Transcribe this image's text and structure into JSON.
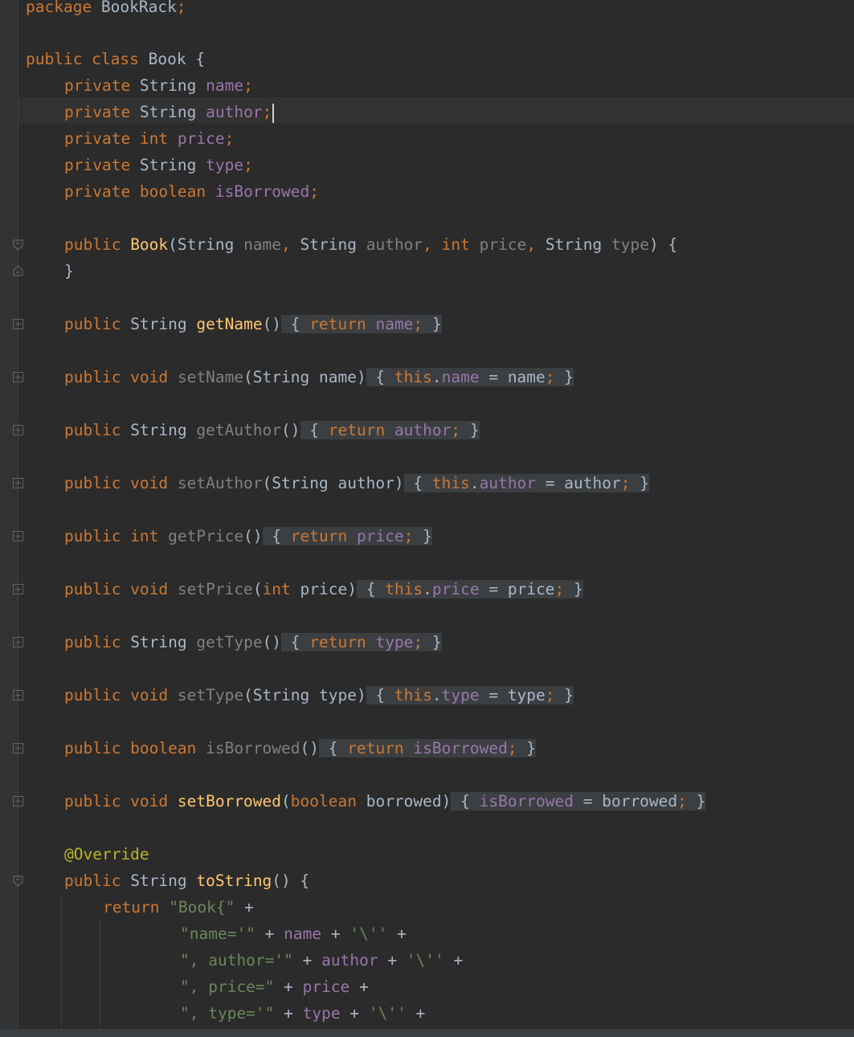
{
  "editor": {
    "language": "java",
    "colors": {
      "background": "#2b2b2b",
      "keyword": "#cc7832",
      "field": "#9876aa",
      "parameter": "#808080",
      "string": "#6a8759",
      "method": "#ffc66d",
      "annotation": "#bbb529",
      "text": "#a9b7c6"
    },
    "code": {
      "l1_kw": "package",
      "l1_name": " BookRack",
      "l1_end": ";",
      "l3_kw": "public class",
      "l3_rest": " Book {",
      "l4_kw": "private",
      "l4_type": " String ",
      "l4_field": "name",
      "l4_end": ";",
      "l5_kw": "private",
      "l5_type": " String ",
      "l5_field": "author",
      "l5_end": ";",
      "l6_kw": "private int",
      "l6_field": " price",
      "l6_end": ";",
      "l7_kw": "private",
      "l7_type": " String ",
      "l7_field": "type",
      "l7_end": ";",
      "l8_kw": "private boolean",
      "l8_field": " isBorrowed",
      "l8_end": ";",
      "ctor_kw": "public",
      "ctor_name": " Book",
      "ctor_open": "(String ",
      "ctor_p1": "name",
      "ctor_c1": ", ",
      "ctor_t2": "String ",
      "ctor_p2": "author",
      "ctor_c2": ", ",
      "ctor_kw3": "int",
      "ctor_p3": " price",
      "ctor_c3": ", ",
      "ctor_t4": "String ",
      "ctor_p4": "type",
      "ctor_close": ") {",
      "ctor_brace": "}",
      "getName_kw": "public",
      "getName_type": " String ",
      "getName_fn": "getName",
      "getName_par": "()",
      "getName_ob": " {",
      "getName_ret": " return",
      "getName_fld": " name",
      "getName_semi": ";",
      "getName_cb": " }",
      "setName_kw": "public void",
      "setName_fn": " setName",
      "setName_par": "(String name)",
      "setName_ob": " {",
      "setName_this": " this",
      "setName_dot": ".",
      "setName_fld": "name",
      "setName_asg": " = name",
      "setName_semi": ";",
      "setName_cb": " }",
      "getAuthor_kw": "public",
      "getAuthor_type": " String ",
      "getAuthor_fn": "getAuthor",
      "getAuthor_par": "()",
      "getAuthor_ob": " {",
      "getAuthor_ret": " return",
      "getAuthor_fld": " author",
      "getAuthor_semi": ";",
      "getAuthor_cb": " }",
      "setAuthor_kw": "public void",
      "setAuthor_fn": " setAuthor",
      "setAuthor_par": "(String author)",
      "setAuthor_ob": " {",
      "setAuthor_this": " this",
      "setAuthor_dot": ".",
      "setAuthor_fld": "author",
      "setAuthor_asg": " = author",
      "setAuthor_semi": ";",
      "setAuthor_cb": " }",
      "getPrice_kw": "public int",
      "getPrice_fn": " getPrice",
      "getPrice_par": "()",
      "getPrice_ob": " {",
      "getPrice_ret": " return",
      "getPrice_fld": " price",
      "getPrice_semi": ";",
      "getPrice_cb": " }",
      "setPrice_kw": "public void",
      "setPrice_fn": " setPrice",
      "setPrice_open": "(",
      "setPrice_int": "int",
      "setPrice_prm": " price)",
      "setPrice_ob": " {",
      "setPrice_this": " this",
      "setPrice_dot": ".",
      "setPrice_fld": "price",
      "setPrice_asg": " = price",
      "setPrice_semi": ";",
      "setPrice_cb": " }",
      "getType_kw": "public",
      "getType_type": " String ",
      "getType_fn": "getType",
      "getType_par": "()",
      "getType_ob": " {",
      "getType_ret": " return",
      "getType_fld": " type",
      "getType_semi": ";",
      "getType_cb": " }",
      "setType_kw": "public void",
      "setType_fn": " setType",
      "setType_par": "(String type)",
      "setType_ob": " {",
      "setType_this": " this",
      "setType_dot": ".",
      "setType_fld": "type",
      "setType_asg": " = type",
      "setType_semi": ";",
      "setType_cb": " }",
      "isB_kw": "public boolean",
      "isB_fn": " isBorrowed",
      "isB_par": "()",
      "isB_ob": " {",
      "isB_ret": " return",
      "isB_fld": " isBorrowed",
      "isB_semi": ";",
      "isB_cb": " }",
      "setB_kw": "public void",
      "setB_fn": " setBorrowed",
      "setB_open": "(",
      "setB_bool": "boolean",
      "setB_prm": " borrowed)",
      "setB_ob": " {",
      "setB_fld": " isBorrowed",
      "setB_asg": " = borrowed",
      "setB_semi": ";",
      "setB_cb": " }",
      "override": "@Override",
      "toString_kw": "public",
      "toString_type": " String ",
      "toString_fn": "toString",
      "toString_rest": "() {",
      "ret_kw": "return",
      "ret_str": " \"Book{\"",
      "ret_plus": " +",
      "n_str": "\"name='\"",
      "n_plus1": " + ",
      "n_fld": "name",
      "n_plus2": " + ",
      "n_chr": "'\\''",
      "n_plus3": " +",
      "a_str": "\", author='\"",
      "a_plus1": " + ",
      "a_fld": "author",
      "a_plus2": " + ",
      "a_chr": "'\\''",
      "a_plus3": " +",
      "p_str": "\", price=\"",
      "p_plus1": " + ",
      "p_fld": "price",
      "p_plus2": " +",
      "t_str": "\", type='\"",
      "t_plus1": " + ",
      "t_fld": "type",
      "t_plus2": " + ",
      "t_chr": "'\\''",
      "t_plus3": " +"
    }
  }
}
